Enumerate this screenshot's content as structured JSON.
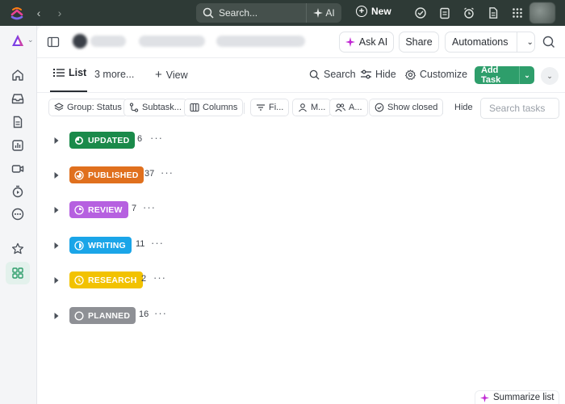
{
  "topbar": {
    "search_label": "Search...",
    "ai_label": "AI",
    "new_label": "New"
  },
  "header": {
    "ask_ai_label": "Ask AI",
    "share_label": "Share",
    "automations_label": "Automations"
  },
  "views": {
    "active_tab": "List",
    "more_label": "3 more...",
    "add_view_label": "View",
    "search_label": "Search",
    "hide_label": "Hide",
    "customize_label": "Customize",
    "add_task_label": "Add Task"
  },
  "filters": {
    "group_label": "Group: Status",
    "subtasks_label": "Subtask...",
    "columns_label": "Columns",
    "filter_label": "Fi...",
    "me_label": "M...",
    "assignees_label": "A...",
    "show_closed_label": "Show closed",
    "hide_label": "Hide",
    "search_placeholder": "Search tasks"
  },
  "groups": [
    {
      "label": "UPDATED",
      "count": "6",
      "color": "#1a8a4a",
      "icon": "updated-status-icon"
    },
    {
      "label": "PUBLISHED",
      "count": "37",
      "color": "#e0701e",
      "icon": "published-status-icon"
    },
    {
      "label": "REVIEW",
      "count": "7",
      "color": "#b660e0",
      "icon": "review-status-icon"
    },
    {
      "label": "WRITING",
      "count": "11",
      "color": "#1aa5e8",
      "icon": "writing-status-icon"
    },
    {
      "label": "RESEARCH",
      "count": "2",
      "color": "#f2c200",
      "icon": "research-status-icon"
    },
    {
      "label": "PLANNED",
      "count": "16",
      "color": "#8e9095",
      "icon": "planned-status-icon"
    }
  ],
  "more_glyph": "···",
  "summarize_label": "Summarize list",
  "colors": {
    "accent_green": "#2e9e6b",
    "topbar_bg": "#2e3a36"
  }
}
